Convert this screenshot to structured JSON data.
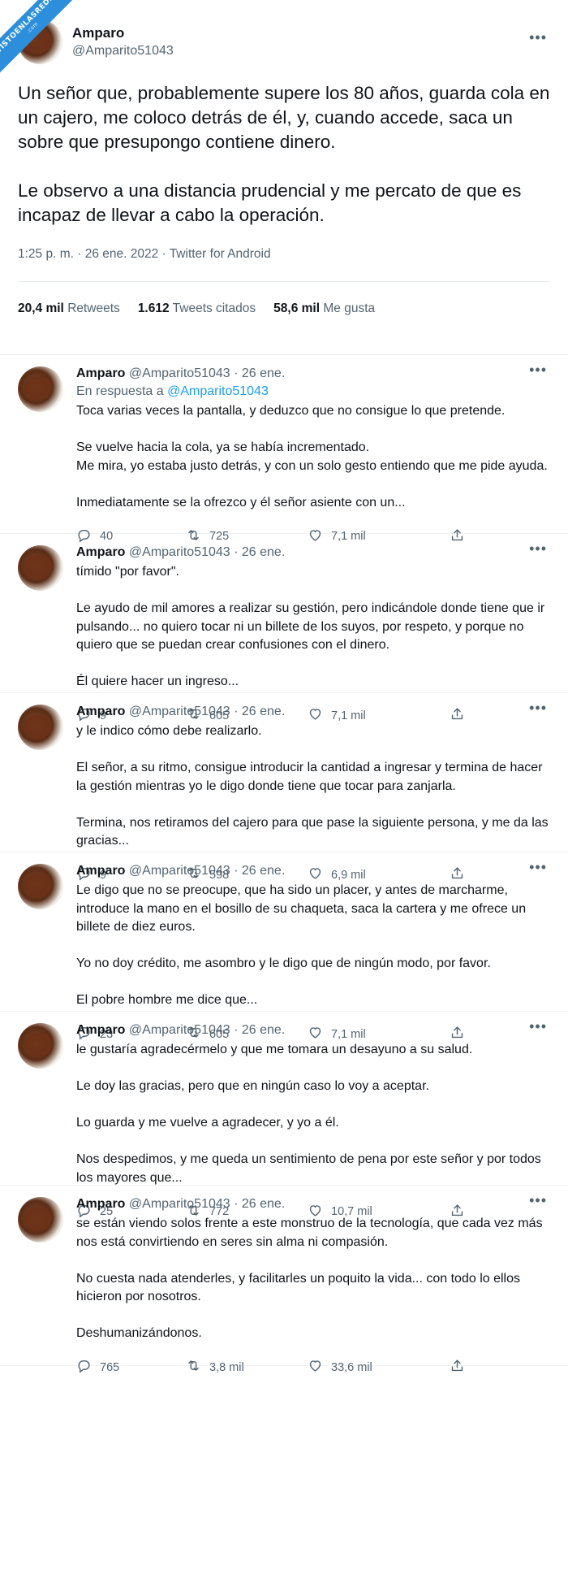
{
  "watermark": {
    "line1": "VISTOENLASREDES",
    "line2": ".com"
  },
  "main_tweet": {
    "name": "Amparo",
    "handle": "@Amparito51043",
    "text": "Un señor que, probablemente supere los 80 años, guarda cola en un cajero, me coloco detrás de él, y, cuando accede, saca un sobre que presupongo contiene dinero.\n\nLe observo a una distancia prudencial y me percato de que es incapaz de llevar a cabo la operación.",
    "meta": "1:25 p. m. · 26 ene. 2022 · Twitter for Android",
    "retweets_count": "20,4 mil",
    "retweets_label": "Retweets",
    "quotes_count": "1.612",
    "quotes_label": "Tweets citados",
    "likes_count": "58,6 mil",
    "likes_label": "Me gusta"
  },
  "replies": [
    {
      "name": "Amparo",
      "handle_date": "@Amparito51043 · 26 ene.",
      "in_reply_prefix": "En respuesta a",
      "in_reply_handle": "@Amparito51043",
      "paragraphs": [
        "Toca varias veces la pantalla, y deduzco que no consigue lo que pretende.",
        "Se vuelve hacia la cola, ya se había incrementado.\nMe mira, yo estaba justo detrás, y con un solo gesto entiendo que me pide ayuda.",
        "Inmediatamente se la ofrezco y él señor asiente con un..."
      ],
      "replies": "40",
      "retweets": "725",
      "likes": "7,1 mil"
    },
    {
      "name": "Amparo",
      "handle_date": "@Amparito51043 · 26 ene.",
      "paragraphs": [
        "tímido \"por favor\".",
        "Le ayudo de mil amores a realizar su gestión, pero indicándole donde tiene que ir pulsando... no quiero tocar ni un billete de los suyos, por respeto, y porque no quiero que se puedan crear confusiones con el dinero.",
        "Él quiere hacer un ingreso..."
      ],
      "replies": "9",
      "retweets": "605",
      "likes": "7,1 mil"
    },
    {
      "name": "Amparo",
      "handle_date": "@Amparito51043 · 26 ene.",
      "paragraphs": [
        "y le indico cómo debe realizarlo.",
        "El señor, a su ritmo, consigue introducir la cantidad a ingresar y termina de hacer la gestión mientras yo le digo donde tiene que tocar para zanjarla.",
        "Termina, nos retiramos del cajero para que pase la siguiente persona, y me da las gracias..."
      ],
      "replies": "9",
      "retweets": "598",
      "likes": "6,9 mil"
    },
    {
      "name": "Amparo",
      "handle_date": "@Amparito51043 · 26 ene.",
      "paragraphs": [
        "Le digo que no se preocupe, que ha sido un placer, y antes de marcharme, introduce la mano en el bosillo de su chaqueta, saca la cartera y me ofrece un billete de diez euros.",
        "Yo no doy crédito, me asombro y le digo que de ningún modo, por favor.",
        "El pobre hombre me dice que..."
      ],
      "replies": "23",
      "retweets": "605",
      "likes": "7,1 mil"
    },
    {
      "name": "Amparo",
      "handle_date": "@Amparito51043 · 26 ene.",
      "paragraphs": [
        "le gustaría agradecérmelo y que me tomara un desayuno a su salud.",
        "Le doy las gracias, pero que en ningún caso lo voy a aceptar.",
        "Lo guarda y me vuelve a agradecer, y yo a él.",
        "Nos despedimos, y me queda un sentimiento de pena por este señor y por todos los mayores que..."
      ],
      "replies": "25",
      "retweets": "772",
      "likes": "10,7 mil"
    },
    {
      "name": "Amparo",
      "handle_date": "@Amparito51043 · 26 ene.",
      "paragraphs": [
        "se están viendo solos frente a este monstruo de la tecnología, que cada vez más nos está convirtiendo en seres sin alma ni compasión.",
        "No cuesta nada atenderles, y facilitarles un poquito la vida... con todo lo ellos hicieron por nosotros.",
        "Deshumanizándonos."
      ],
      "replies": "765",
      "retweets": "3,8 mil",
      "likes": "33,6 mil"
    }
  ],
  "colors": {
    "link": "#1d9bf0",
    "muted": "#536471",
    "text": "#0f1419"
  }
}
